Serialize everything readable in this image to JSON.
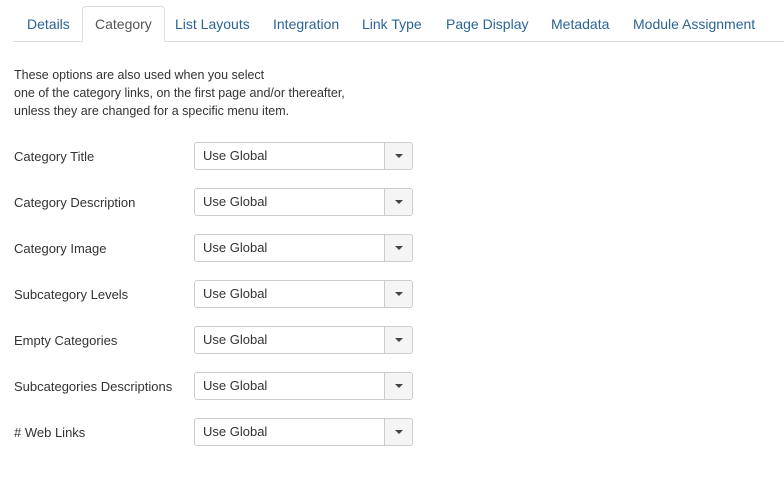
{
  "tabs": [
    {
      "label": "Details"
    },
    {
      "label": "Category"
    },
    {
      "label": "List Layouts"
    },
    {
      "label": "Integration"
    },
    {
      "label": "Link Type"
    },
    {
      "label": "Page Display"
    },
    {
      "label": "Metadata"
    },
    {
      "label": "Module Assignment"
    }
  ],
  "active_tab": "Category",
  "intro": {
    "line1": "These options are also used when you select",
    "line2": "one of the category links, on the first page and/or thereafter,",
    "line3": "unless they are changed for a specific menu item."
  },
  "fields": [
    {
      "label": "Category Title",
      "value": "Use Global"
    },
    {
      "label": "Category Description",
      "value": "Use Global"
    },
    {
      "label": "Category Image",
      "value": "Use Global"
    },
    {
      "label": "Subcategory Levels",
      "value": "Use Global"
    },
    {
      "label": "Empty Categories",
      "value": "Use Global"
    },
    {
      "label": "Subcategories Descriptions",
      "value": "Use Global"
    },
    {
      "label": "# Web Links",
      "value": "Use Global"
    }
  ],
  "colors": {
    "link": "#2a6496",
    "text": "#333333",
    "border": "#cccccc"
  },
  "icons": {
    "dropdown": "caret-down-icon"
  }
}
